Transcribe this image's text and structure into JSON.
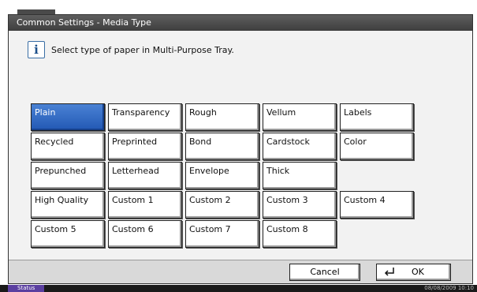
{
  "window": {
    "title": "Common Settings - Media Type"
  },
  "info": {
    "icon": "info-icon",
    "message": "Select type of paper in Multi-Purpose Tray."
  },
  "media_types": [
    {
      "label": "Plain",
      "selected": true
    },
    {
      "label": "Transparency",
      "selected": false
    },
    {
      "label": "Rough",
      "selected": false
    },
    {
      "label": "Vellum",
      "selected": false
    },
    {
      "label": "Labels",
      "selected": false
    },
    {
      "label": "Recycled",
      "selected": false
    },
    {
      "label": "Preprinted",
      "selected": false
    },
    {
      "label": "Bond",
      "selected": false
    },
    {
      "label": "Cardstock",
      "selected": false
    },
    {
      "label": "Color",
      "selected": false
    },
    {
      "label": "Prepunched",
      "selected": false
    },
    {
      "label": "Letterhead",
      "selected": false
    },
    {
      "label": "Envelope",
      "selected": false
    },
    {
      "label": "Thick",
      "selected": false
    },
    {
      "label": "",
      "selected": false,
      "empty": true
    },
    {
      "label": "High Quality",
      "selected": false
    },
    {
      "label": "Custom 1",
      "selected": false
    },
    {
      "label": "Custom 2",
      "selected": false
    },
    {
      "label": "Custom 3",
      "selected": false
    },
    {
      "label": "Custom 4",
      "selected": false
    },
    {
      "label": "Custom 5",
      "selected": false
    },
    {
      "label": "Custom 6",
      "selected": false
    },
    {
      "label": "Custom 7",
      "selected": false
    },
    {
      "label": "Custom 8",
      "selected": false
    }
  ],
  "footer": {
    "cancel_label": "Cancel",
    "ok_label": "OK",
    "ok_icon": "enter-icon"
  },
  "statusbar": {
    "status_label": "Status",
    "datetime": "08/08/2009   10:10"
  },
  "colors": {
    "selected": "#2f6bc4",
    "status_tab": "#5b3fa0"
  }
}
